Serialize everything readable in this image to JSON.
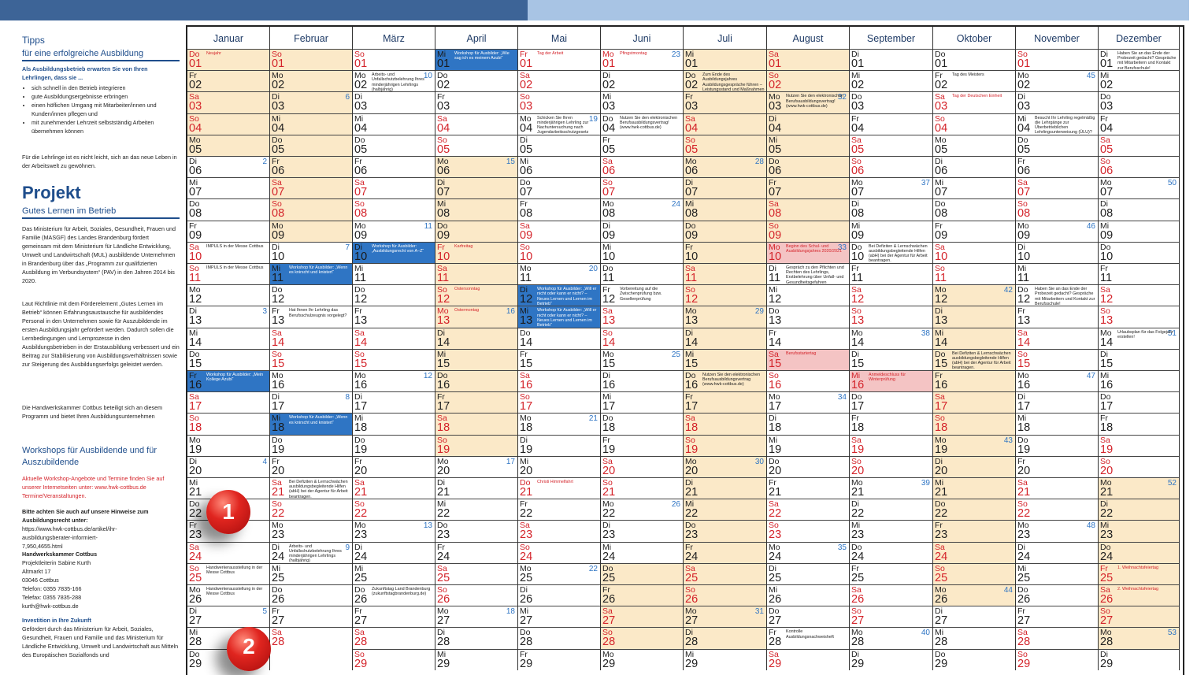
{
  "sidebar": {
    "tipps_title": "Tipps",
    "tipps_subtitle": "für eine erfolgreiche Ausbildung",
    "tipps_intro": "Als Ausbildungsbetrieb erwarten Sie von Ihren Lehrlingen, dass sie ...",
    "bullets": [
      "sich schnell in den Betrieb integrieren",
      "gute Ausbildungsergebnisse erbringen",
      "einen höflichen Umgang mit Mitarbeiter/innen und Kunden/innen pflegen und",
      "mit zunehmender Lehrzeit selbstständig Arbeiten übernehmen können"
    ],
    "tipps_outro": "Für die Lehrlinge ist es nicht leicht, sich an das neue Leben in der Arbeitswelt zu gewöhnen.",
    "projekt_title": "Projekt",
    "projekt_subtitle": "Gutes Lernen im Betrieb",
    "projekt_p1": "Das Ministerium für Arbeit, Soziales, Gesundheit, Frauen und Familie (MASGF) des Landes Brandenburg fördert gemeinsam mit dem Ministerium für Ländliche Entwicklung, Umwelt und Landwirtschaft (MUL) ausbildende Unternehmen in Brandenburg über das „Programm zur qualifizierten Ausbildung im Verbundsystem“ (PAV) in den Jahren 2014 bis 2020.",
    "projekt_p2": "Laut Richtlinie mit dem Förderelement „Gutes Lernen im Betrieb“ können Erfahrungsaustausche für ausbildendes Personal in den Unternehmen sowie für Auszubildende im ersten Ausbildungsjahr gefördert werden. Dadurch sollen die Lernbedingungen und Lernprozesse in den Ausbildungsbetrieben in der Erstausbildung verbessert und ein Beitrag zur Stabilisierung von Ausbildungsverhältnissen sowie zur Steigerung des Ausbildungserfolgs geleistet werden.",
    "projekt_p3": "Die Handwerkskammer Cottbus beteiligt sich an diesem Programm und bietet Ihren Ausbildungsunternehmen",
    "workshops_title": "Workshops für Ausbildende und für Auszubildende",
    "workshops_red": "Aktuelle Workshop-Angebote und Termine finden Sie auf unserer Internetseiten unter: www.hwk-cottbus.de Termine/Veranstaltungen.",
    "hinweis_bold": "Bitte achten Sie auch auf unsere Hinweise zum Ausbildungsrecht unter:",
    "hinweis_url": "https://www.hwk-cottbus.de/artikel/ihr-ausbildungsberater-informiert-7,950,4655.html",
    "contact_org": "Handwerkskammer Cottbus",
    "contact_lines": [
      "Projektleiterin Sabine Kurth",
      "Altmarkt 17",
      "03046 Cottbus",
      "Telefon: 0355 7835-166",
      "Telefax: 0355 7835-288",
      "kurth@hwk-cottbus.de"
    ],
    "invest_title": "Investition in Ihre Zukunft",
    "invest_text": "Gefördert durch das Ministerium für Arbeit, Soziales, Gesundheit, Frauen und Familie und das Ministerium für Ländliche Entwicklung, Umwelt und Landwirtschaft aus Mitteln des Europäischen Sozialfonds und",
    "pin1": "1",
    "pin2": "2"
  },
  "calendar": {
    "months": [
      {
        "name": "Januar",
        "start": 3,
        "len": 31,
        "hol": [
          1,
          2,
          3,
          4,
          5
        ],
        "blue": [
          16
        ],
        "pink": [],
        "weeks": {
          "6": "2",
          "13": "3",
          "20": "4",
          "27": "5"
        },
        "notes": {
          "1": {
            "t": "Neujahr",
            "red": true
          },
          "10": {
            "t": "IMPULS in der Messe Cottbus"
          },
          "11": {
            "t": "IMPULS in der Messe Cottbus"
          },
          "16": {
            "t": "Workshop für Ausbilder: „Mein Kollege Azubi“"
          },
          "25": {
            "t": "Handwerkerausstellung in der Messe Cottbus"
          },
          "26": {
            "t": "Handwerkerausstellung in der Messe Cottbus"
          }
        }
      },
      {
        "name": "Februar",
        "start": 6,
        "len": 28,
        "hol": [
          1,
          2,
          3,
          4,
          5,
          6,
          7,
          8,
          9
        ],
        "blue": [
          11,
          18
        ],
        "pink": [],
        "weeks": {
          "3": "6",
          "10": "7",
          "17": "8",
          "24": "9"
        },
        "notes": {
          "11": {
            "t": "Workshop für Ausbilder: „Wenn es knirscht und knistert“"
          },
          "13": {
            "t": "Hat Ihnen Ihr Lehrling das Berufsschulzeugnis vorgelegt?"
          },
          "18": {
            "t": "Workshop für Ausbilder: „Wenn es knirscht und knistert“"
          },
          "21": {
            "t": "Bei Defiziten & Lernschwächen ausbildungsbegleitende Hilfen (abH) bei der Agentur für Arbeit beantragen."
          },
          "24": {
            "t": "Arbeits- und Unfallschutzbelehrung Ihres minderjährigen Lehrlings (halbjährig)"
          }
        }
      },
      {
        "name": "März",
        "start": 6,
        "len": 31,
        "hol": [],
        "blue": [
          10
        ],
        "pink": [],
        "weeks": {
          "2": "10",
          "9": "11",
          "16": "12",
          "23": "13"
        },
        "notes": {
          "2": {
            "t": "Arbeits- und Unfallschutzbelehrung Ihres minderjährigen Lehrlings (halbjährig)"
          },
          "10": {
            "t": "Workshop für Ausbilder: „Ausbildungsrecht von A–Z“"
          },
          "26": {
            "t": "Zukunftstag Land Brandenburg (zukunftstagbrandenburg.de)"
          }
        }
      },
      {
        "name": "April",
        "start": 2,
        "len": 30,
        "hol": [
          6,
          7,
          8,
          9,
          10,
          11,
          12,
          13,
          14,
          15,
          16,
          17,
          18,
          19
        ],
        "blue": [
          1
        ],
        "pink": [],
        "weeks": {
          "6": "15",
          "13": "16",
          "20": "17",
          "27": "18"
        },
        "notes": {
          "1": {
            "t": "Workshop für Ausbilder: „Wie sag ich es meinem Azubi“"
          },
          "10": {
            "t": "Karfreitag",
            "red": true
          },
          "12": {
            "t": "Ostersonntag",
            "red": true
          },
          "13": {
            "t": "Ostermontag",
            "red": true
          }
        }
      },
      {
        "name": "Mai",
        "start": 4,
        "len": 31,
        "hol": [],
        "blue": [
          12,
          13
        ],
        "pink": [],
        "weeks": {
          "4": "19",
          "11": "20",
          "18": "21",
          "25": "22"
        },
        "notes": {
          "1": {
            "t": "Tag der Arbeit",
            "red": true
          },
          "4": {
            "t": "Schicken Sie Ihren minderjährigen Lehrling zur Nachuntersuchung nach Jugendarbeitsschutzgesetz (JArbSchG)"
          },
          "12": {
            "t": "Workshop für Ausbilder: „Will er nicht oder kann er nicht? – Neues Lernen und Lernen im Betrieb“"
          },
          "13": {
            "t": "Workshop für Ausbilder: „Will er nicht oder kann er nicht? – Neues Lernen und Lernen im Betrieb“"
          },
          "21": {
            "t": "Christi Himmelfahrt",
            "red": true
          }
        }
      },
      {
        "name": "Juni",
        "start": 0,
        "len": 30,
        "hol": [
          25,
          26,
          27,
          28
        ],
        "blue": [],
        "pink": [],
        "weeks": {
          "1": "23",
          "8": "24",
          "15": "25",
          "22": "26"
        },
        "notes": {
          "1": {
            "t": "Pfingstmontag",
            "red": true
          },
          "4": {
            "t": "Nutzen Sie den elektronischen Berufsausbildungsvertrag! (www.hwk-cottbus.de)"
          },
          "12": {
            "t": "Vorbereitung auf die Zwischenprüfung bzw. Gesellenprüfung"
          }
        }
      },
      {
        "name": "Juli",
        "start": 2,
        "len": 31,
        "hol": [
          1,
          2,
          3,
          4,
          5,
          6,
          7,
          8,
          9,
          10,
          11,
          12,
          13,
          14,
          15,
          16,
          17,
          18,
          19,
          20,
          21,
          22,
          23,
          24,
          25,
          26,
          27,
          28
        ],
        "blue": [],
        "pink": [],
        "weeks": {
          "6": "28",
          "13": "29",
          "20": "30",
          "27": "31"
        },
        "notes": {
          "2": {
            "t": "Zum Ende des Ausbildungsjahres Ausbildungsgespräche führen – Leistungsstand und Maßnahmen festlegen."
          },
          "16": {
            "t": "Nutzen Sie den elektronischen Berufsausbildungsvertrag (www.hwk-cottbus.de)"
          }
        }
      },
      {
        "name": "August",
        "start": 5,
        "len": 31,
        "hol": [
          1,
          2,
          3,
          4,
          5,
          6,
          7,
          8,
          9
        ],
        "blue": [],
        "pink": [
          10,
          15
        ],
        "weeks": {
          "3": "32",
          "10": "33",
          "17": "34",
          "24": "35"
        },
        "notes": {
          "3": {
            "t": "Nutzen Sie den elektronischen Berufsausbildungsvertrag! (www.hwk-cottbus.de)"
          },
          "10": {
            "t": "Beginn des Schul- und Ausbildungsjahres 2020/2021",
            "red": true
          },
          "11": {
            "t": "Gespräch zu den Pflichten und Rechten des Lehrlings, Erstbelehrung über Unfall- und Gesundheitsgefahren"
          },
          "15": {
            "t": "Berufsstartertag",
            "red": true
          },
          "28": {
            "t": "Kontrolle Ausbildungsnachweisheft"
          }
        }
      },
      {
        "name": "September",
        "start": 1,
        "len": 30,
        "hol": [],
        "blue": [],
        "pink": [
          16
        ],
        "weeks": {
          "7": "37",
          "14": "38",
          "21": "39",
          "28": "40"
        },
        "notes": {
          "10": {
            "t": "Bei Defiziten & Lernschwächen ausbildungsbegleitende Hilfen (abH) bei der Agentur für Arbeit beantragen."
          },
          "16": {
            "t": "Anmeldeschluss für Winterprüfung",
            "red": true
          }
        }
      },
      {
        "name": "Oktober",
        "start": 3,
        "len": 31,
        "hol": [
          12,
          13,
          14,
          15,
          16,
          17,
          18,
          19,
          20,
          21,
          22,
          23,
          24,
          25,
          26
        ],
        "blue": [],
        "pink": [],
        "weeks": {
          "12": "42",
          "19": "43",
          "26": "44"
        },
        "notes": {
          "2": {
            "t": "Tag des Meisters"
          },
          "3": {
            "t": "Tag der Deutschen Einheit",
            "red": true
          },
          "15": {
            "t": "Bei Defiziten & Lernschwächen ausbildungsbegleitende Hilfen (abH) bei der Agentur für Arbeit beantragen."
          }
        }
      },
      {
        "name": "November",
        "start": 6,
        "len": 30,
        "hol": [],
        "blue": [],
        "pink": [],
        "weeks": {
          "2": "45",
          "9": "46",
          "16": "47",
          "23": "48"
        },
        "notes": {
          "4": {
            "t": "Besucht Ihr Lehrling regelmäßig die Lehrgänge zur Überbetrieblichen Lehrlingsunterweisung (ÜLU)?"
          },
          "12": {
            "t": "Haben Sie an das Ende der Probezeit gedacht? Gespräche mit Mitarbeitern und Kontakt zur Berufsschule!"
          }
        }
      },
      {
        "name": "Dezember",
        "start": 1,
        "len": 31,
        "hol": [
          21,
          22,
          23,
          24,
          25,
          26,
          27,
          28
        ],
        "blue": [],
        "pink": [],
        "weeks": {
          "7": "50",
          "14": "51",
          "21": "52",
          "28": "53"
        },
        "notes": {
          "1": {
            "t": "Haben Sie an das Ende der Probezeit gedacht? Gespräche mit Mitarbeitern und Kontakt zur Berufsschule!"
          },
          "14": {
            "t": "Urlaubsplan für das Folgejahr erstellen!"
          },
          "25": {
            "t": "1. Weihnachtsfeiertag",
            "red": true
          },
          "26": {
            "t": "2. Weihnachtsfeiertag",
            "red": true
          }
        }
      }
    ],
    "weekdays": [
      "Mo",
      "Di",
      "Mi",
      "Do",
      "Fr",
      "Sa",
      "So"
    ]
  },
  "colors": {
    "header_blue": "#3d6497",
    "light_blue": "#a8c4e4",
    "holiday": "#fbe9c8",
    "workshop": "#2f75c4",
    "weekend_red": "#d4232a"
  }
}
